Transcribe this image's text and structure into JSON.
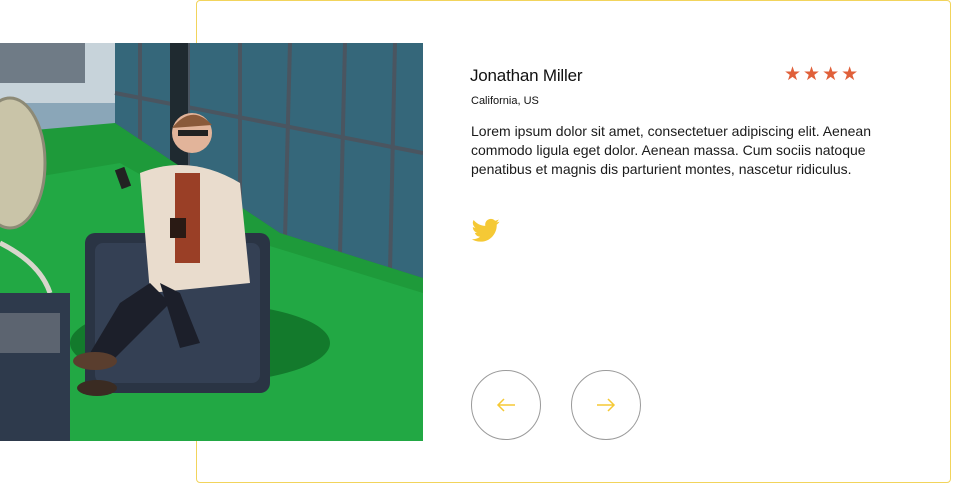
{
  "testimonial": {
    "name": "Jonathan Miller",
    "location": "California, US",
    "rating": 4,
    "rating_max": 4,
    "review": "Lorem ipsum dolor sit amet, consectetuer adipiscing elit. Aenean commodo ligula eget dolor. Aenean massa. Cum sociis natoque penatibus et magnis dis parturient montes, nascetur ridiculus.",
    "social_icon": "twitter-icon"
  },
  "stars": [
    "★",
    "★",
    "★",
    "★"
  ],
  "navigation": {
    "prev_icon": "arrow-left-icon",
    "next_icon": "arrow-right-icon"
  },
  "colors": {
    "accent_yellow": "#f5c935",
    "border_yellow": "#f2d45c",
    "star_orange": "#e0603a",
    "text": "#111111"
  }
}
